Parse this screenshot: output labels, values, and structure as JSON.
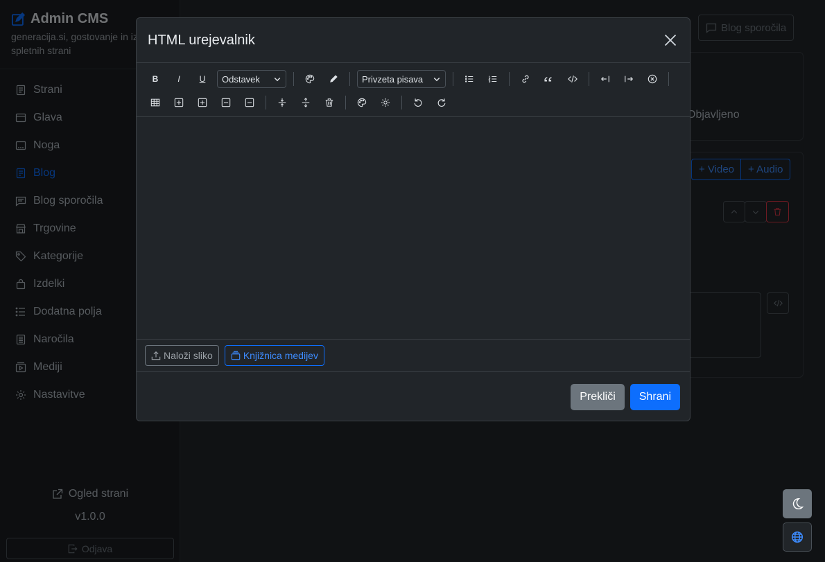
{
  "sidebar": {
    "brand_title": "Admin CMS",
    "brand_subtitle": "generacija.si, gostovanje in izdelava spletnih strani",
    "items": [
      {
        "label": "Strani",
        "icon": "file-icon"
      },
      {
        "label": "Glava",
        "icon": "window-icon"
      },
      {
        "label": "Noga",
        "icon": "window-bottom-icon"
      },
      {
        "label": "Blog",
        "icon": "blog-icon",
        "active": true
      },
      {
        "label": "Blog sporočila",
        "icon": "chat-icon"
      },
      {
        "label": "Trgovine",
        "icon": "shop-icon"
      },
      {
        "label": "Kategorije",
        "icon": "tag-icon"
      },
      {
        "label": "Izdelki",
        "icon": "bag-icon"
      },
      {
        "label": "Dodatna polja",
        "icon": "list-icon"
      },
      {
        "label": "Naročila",
        "icon": "receipt-icon"
      },
      {
        "label": "Mediji",
        "icon": "media-icon"
      },
      {
        "label": "Nastavitve",
        "icon": "gear-icon"
      }
    ],
    "preview_label": "Ogled strani",
    "version": "v1.0.0",
    "logout_label": "Odjava"
  },
  "background": {
    "blog_messages_button": "Blog sporočila",
    "status_text": "Objavljeno",
    "video_button": "+ Video",
    "audio_button": "+ Audio"
  },
  "modal": {
    "title": "HTML urejevalnik",
    "toolbar": {
      "bold": "B",
      "italic": "I",
      "underline": "U",
      "paragraph_select": "Odstavek",
      "font_select": "Privzeta pisava"
    },
    "upload_label": "Naloži sliko",
    "library_label": "Knjižnica medijev",
    "cancel_label": "Prekliči",
    "save_label": "Shrani"
  },
  "colors": {
    "accent": "#0d6efd",
    "secondary": "#6c757d",
    "danger": "#dc3545"
  }
}
